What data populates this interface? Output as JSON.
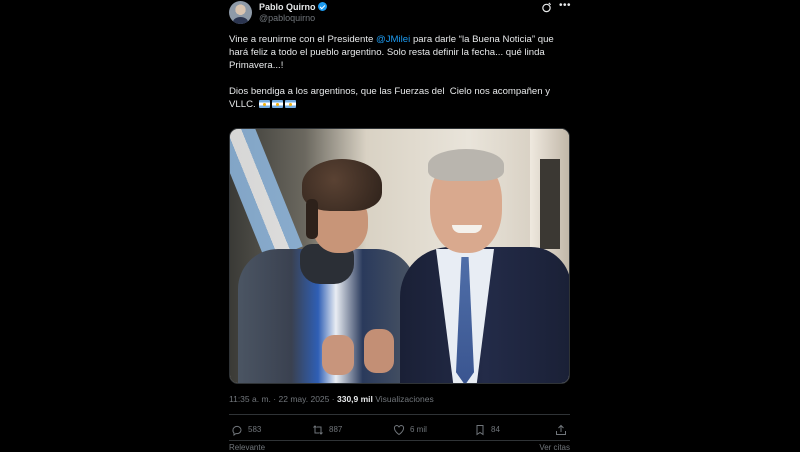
{
  "author": {
    "display_name": "Pablo Quirno",
    "handle": "@pabloquirno"
  },
  "tweet": {
    "text_before_mention": "Vine a reunirme con el Presidente ",
    "mention": "@JMilei",
    "text_after_mention": " para darle “la Buena Noticia” que hará feliz a todo el pueblo argentino. Solo resta definir la fecha... qué linda Primavera...!\n\nDios bendiga a los argentinos, que las Fuerzas del  Cielo nos acompañen y VLLC. ",
    "flags": [
      "argentina-flag",
      "argentina-flag",
      "argentina-flag"
    ]
  },
  "meta": {
    "time": "11:35 a. m.",
    "separator": "·",
    "date": "22 may. 2025",
    "views_count": "330,9 mil",
    "views_label": "Visualizaciones"
  },
  "actions": {
    "replies": "583",
    "reposts": "887",
    "likes": "6 mil",
    "bookmarks": "84"
  },
  "footer": {
    "left": "Relevante",
    "right": "Ver citas"
  },
  "icons": [
    "avatar",
    "verified-icon",
    "grok-icon",
    "more-icon",
    "reply-icon",
    "repost-icon",
    "like-icon",
    "bookmark-icon",
    "share-icon"
  ],
  "colors": {
    "background": "#000000",
    "text": "#e7e9ea",
    "secondary": "#71767b",
    "accent": "#1d9bf0",
    "divider": "#2f3336"
  }
}
